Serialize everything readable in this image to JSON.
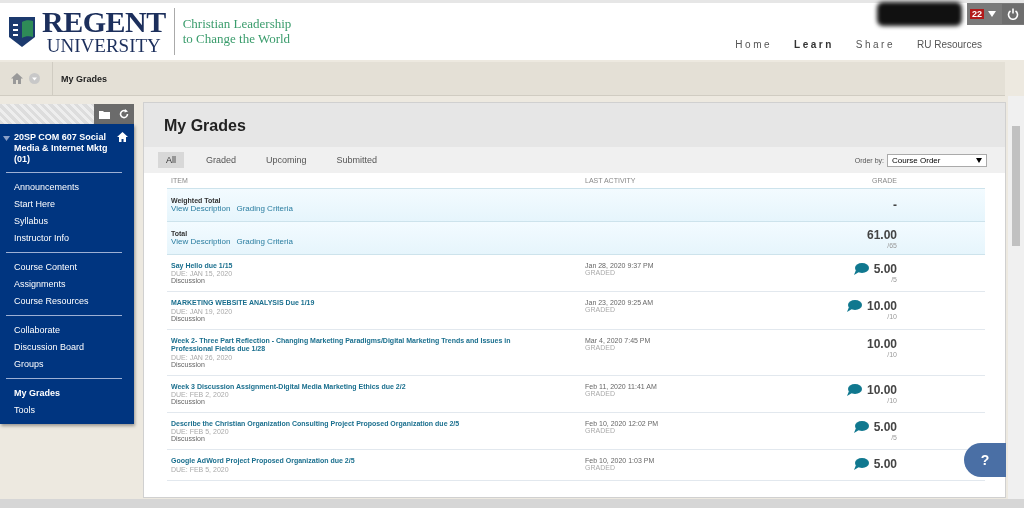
{
  "header": {
    "logo_name": "REGENT",
    "logo_sub": "UNIVERSITY",
    "tagline_1": "Christian Leadership",
    "tagline_2": "to Change the World",
    "notification_count": "22",
    "nav": [
      {
        "label": "Home",
        "selected": false
      },
      {
        "label": "Learn",
        "selected": true
      },
      {
        "label": "Share",
        "selected": false
      },
      {
        "label": "RU Resources",
        "selected": false
      }
    ]
  },
  "breadcrumb": {
    "current": "My Grades"
  },
  "sidebar": {
    "course_title": "20SP COM 607 Social Media & Internet Mktg (01)",
    "groups": [
      {
        "items": [
          {
            "label": "Announcements",
            "selected": false
          },
          {
            "label": "Start Here",
            "selected": false
          },
          {
            "label": "Syllabus",
            "selected": false
          },
          {
            "label": "Instructor Info",
            "selected": false
          }
        ]
      },
      {
        "items": [
          {
            "label": "Course Content",
            "selected": false
          },
          {
            "label": "Assignments",
            "selected": false
          },
          {
            "label": "Course Resources",
            "selected": false
          }
        ]
      },
      {
        "items": [
          {
            "label": "Collaborate",
            "selected": false
          },
          {
            "label": "Discussion Board",
            "selected": false
          },
          {
            "label": "Groups",
            "selected": false
          }
        ]
      },
      {
        "items": [
          {
            "label": "My Grades",
            "selected": true
          },
          {
            "label": "Tools",
            "selected": false
          }
        ]
      }
    ]
  },
  "page": {
    "title": "My Grades",
    "filters": [
      {
        "label": "All",
        "selected": true
      },
      {
        "label": "Graded",
        "selected": false
      },
      {
        "label": "Upcoming",
        "selected": false
      },
      {
        "label": "Submitted",
        "selected": false
      }
    ],
    "order_by": {
      "label": "Order by:",
      "value": "Course Order"
    },
    "table": {
      "columns": [
        "ITEM",
        "LAST ACTIVITY",
        "GRADE"
      ],
      "rows": [
        {
          "kind": "total",
          "title": "Weighted Total",
          "links": [
            "View Description",
            "Grading Criteria"
          ],
          "grade": "-"
        },
        {
          "kind": "total",
          "title": "Total",
          "links": [
            "View Description",
            "Grading Criteria"
          ],
          "grade": "61.00",
          "out_of": "/65"
        },
        {
          "kind": "item",
          "title": "Say Hello due 1/15",
          "due": "DUE: JAN 15, 2020",
          "type": "Discussion",
          "activity": "Jan 28, 2020 9:37 PM",
          "status": "GRADED",
          "comment": true,
          "grade": "5.00",
          "out_of": "/5"
        },
        {
          "kind": "item",
          "title": "MARKETING WEBSITE ANALYSIS Due 1/19",
          "due": "DUE: JAN 19, 2020",
          "type": "Discussion",
          "activity": "Jan 23, 2020 9:25 AM",
          "status": "GRADED",
          "comment": true,
          "grade": "10.00",
          "out_of": "/10"
        },
        {
          "kind": "item",
          "title": "Week 2- Three Part Reflection - Changing Marketing Paradigms/Digital Marketing Trends and Issues in Professional Fields due 1/28",
          "due": "DUE: JAN 26, 2020",
          "type": "Discussion",
          "activity": "Mar 4, 2020 7:45 PM",
          "status": "GRADED",
          "comment": false,
          "grade": "10.00",
          "out_of": "/10"
        },
        {
          "kind": "item",
          "title": "Week 3 Discussion Assignment-Digital Media Marketing Ethics due 2/2",
          "due": "DUE: FEB 2, 2020",
          "type": "Discussion",
          "activity": "Feb 11, 2020 11:41 AM",
          "status": "GRADED",
          "comment": true,
          "grade": "10.00",
          "out_of": "/10"
        },
        {
          "kind": "item",
          "title": "Describe the Christian Organization Consulting Project Proposed Organization due 2/5",
          "due": "DUE: FEB 5, 2020",
          "type": "Discussion",
          "activity": "Feb 10, 2020 12:02 PM",
          "status": "GRADED",
          "comment": true,
          "grade": "5.00",
          "out_of": "/5"
        },
        {
          "kind": "item",
          "title": "Google AdWord Project Proposed Organization due 2/5",
          "due": "DUE: FEB 5, 2020",
          "activity": "Feb 10, 2020 1:03 PM",
          "status": "GRADED",
          "comment": true,
          "grade": "5.00"
        }
      ]
    }
  },
  "help": {
    "label": "?"
  }
}
